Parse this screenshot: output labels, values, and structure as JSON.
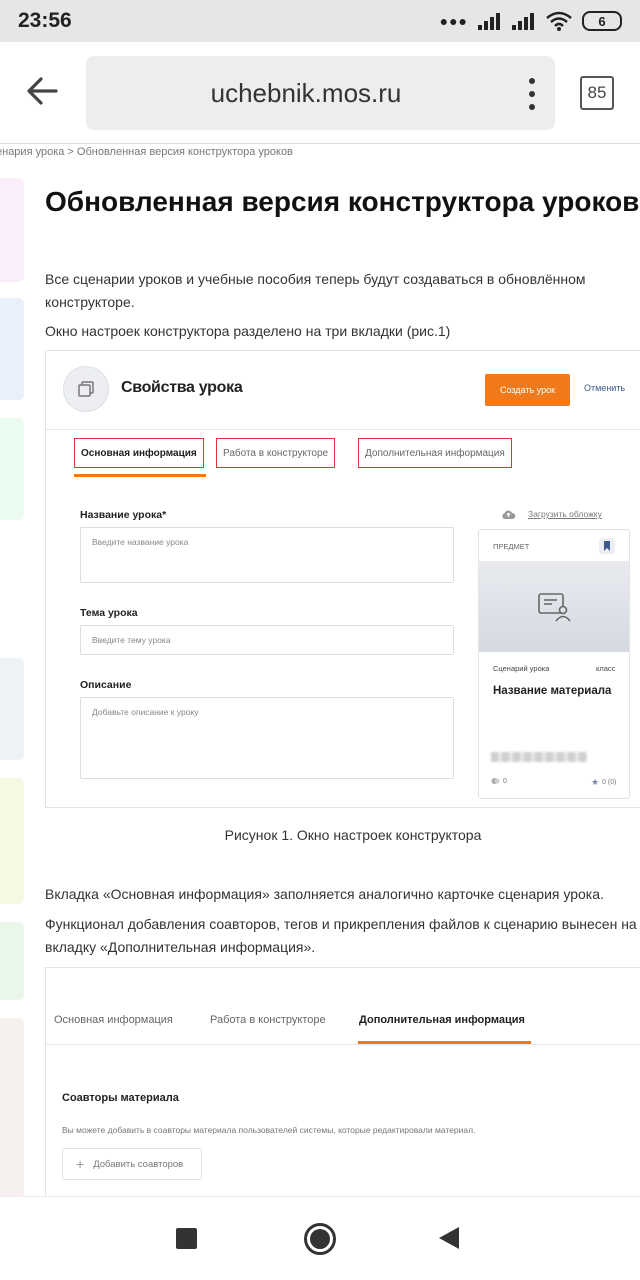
{
  "status_bar": {
    "time": "23:56",
    "battery": "6"
  },
  "browser": {
    "url": "uchebnik.mos.ru",
    "tab_count": "85"
  },
  "breadcrumb": "енария урока > Обновленная версия конструктора уроков",
  "article": {
    "title": "Обновленная версия конструктора уроков",
    "intro_line1": "Все сценарии уроков и учебные пособия теперь будут создаваться в обновлённом",
    "intro_line2": "конструкторе.",
    "tabs_note": "Окно настроек конструктора разделено на три вкладки (рис.1)",
    "caption": "Рисунок 1. Окно настроек конструктора",
    "basic_info_line": "Вкладка «Основная информация» заполняется аналогично карточке сценария урока.",
    "func_line1": "Функционал добавления соавторов, тегов и прикрепления файлов к сценарию вынесен на",
    "func_line2": "вкладку «Дополнительная информация»."
  },
  "figure1": {
    "header_title": "Свойства урока",
    "create_button": "Создать урок",
    "cancel_link": "Отменить",
    "tabs": [
      "Основная информация",
      "Работа в конструкторе",
      "Дополнительная информация"
    ],
    "name_label": "Название урока*",
    "name_placeholder": "Введите название урока",
    "topic_label": "Тема урока",
    "topic_placeholder": "Введите тему урока",
    "description_label": "Описание",
    "description_placeholder": "Добавьте описание к уроку",
    "upload_cover": "Загрузить обложку",
    "card": {
      "subject": "ПРЕДМЕТ",
      "type": "Сценарий урока",
      "grade": "класс",
      "name": "Название материала",
      "views": "0",
      "rating": "0 (0)"
    }
  },
  "figure2": {
    "tabs": [
      "Основная информация",
      "Работа в конструкторе",
      "Дополнительная информация"
    ],
    "coauthors_title": "Соавторы материала",
    "coauthors_desc": "Вы можете добавить в соавторы материала пользователей системы, которые редактировали материал.",
    "add_coauthors": "Добавить соавторов"
  },
  "colors": {
    "accent": "#f07a1b",
    "tab_highlight": "#dd3333",
    "link": "#3a5a8f"
  }
}
